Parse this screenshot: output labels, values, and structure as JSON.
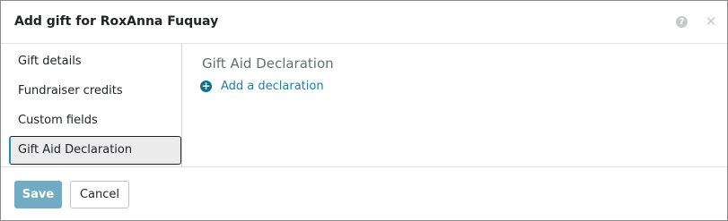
{
  "dialog": {
    "title": "Add gift for RoxAnna Fuquay",
    "help_icon": "question-circle-icon",
    "close_icon": "close-icon"
  },
  "tabs": [
    {
      "label": "Gift details",
      "active": false
    },
    {
      "label": "Fundraiser credits",
      "active": false
    },
    {
      "label": "Custom fields",
      "active": false
    },
    {
      "label": "Gift Aid Declaration",
      "active": true
    }
  ],
  "content": {
    "heading": "Gift Aid Declaration",
    "add_link": {
      "icon": "plus-circle-icon",
      "label": "Add a declaration"
    }
  },
  "footer": {
    "save_label": "Save",
    "cancel_label": "Cancel"
  },
  "colors": {
    "accent": "#1d8fc1",
    "link": "#1c7dac",
    "save_button": "#71acc4"
  }
}
